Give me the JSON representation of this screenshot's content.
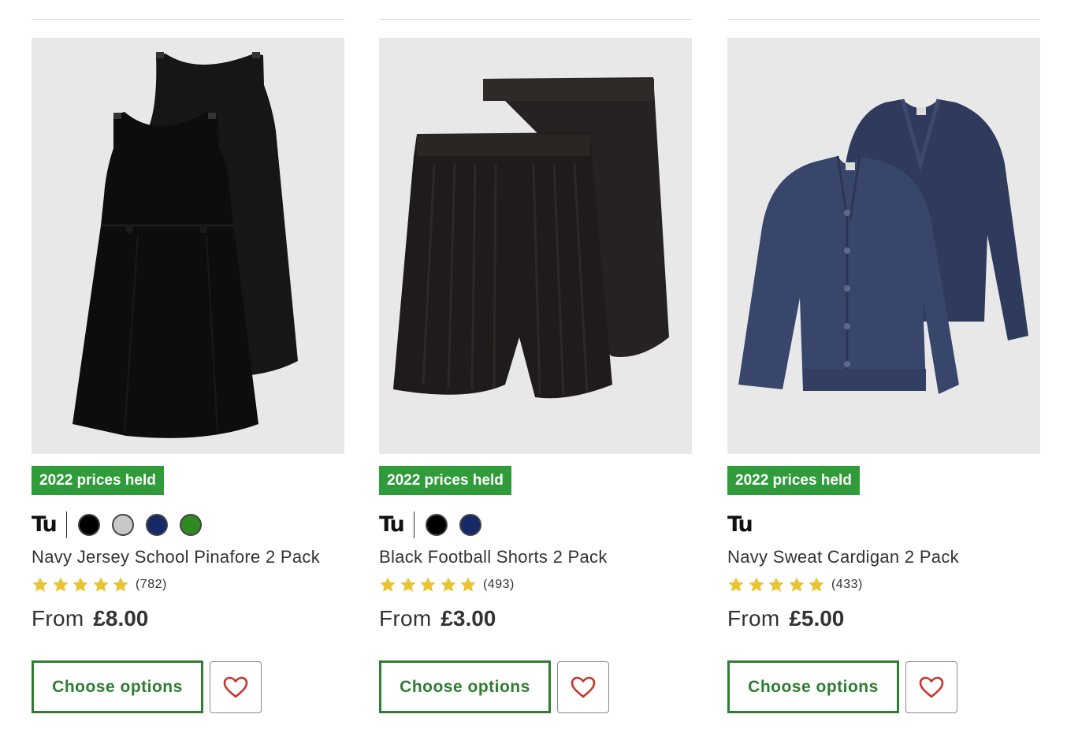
{
  "colors": {
    "badge_bg": "#2f9b3a",
    "button_green": "#2e7d32",
    "star_gold": "#e8c332",
    "heart_red": "#c8342b"
  },
  "products": [
    {
      "image_alt": "Two black sleeveless school pinafore dresses",
      "badge": "2022 prices held",
      "brand": "Tu",
      "swatches": [
        "#000000",
        "#c8c8c8",
        "#152a66",
        "#2f8a22"
      ],
      "title": "Navy Jersey School Pinafore 2 Pack",
      "rating_stars": 5,
      "review_count": "(782)",
      "price_prefix": "From",
      "price": "£8.00",
      "button_label": "Choose options",
      "wishlist_icon": "heart-outline-icon"
    },
    {
      "image_alt": "Two black football shorts",
      "badge": "2022 prices held",
      "brand": "Tu",
      "swatches": [
        "#000000",
        "#152a66"
      ],
      "title": "Black Football Shorts 2 Pack",
      "rating_stars": 5,
      "review_count": "(493)",
      "price_prefix": "From",
      "price": "£3.00",
      "button_label": "Choose options",
      "wishlist_icon": "heart-outline-icon"
    },
    {
      "image_alt": "Two navy sweat cardigans",
      "badge": "2022 prices held",
      "brand": "Tu",
      "swatches": [],
      "title": "Navy Sweat Cardigan 2 Pack",
      "rating_stars": 5,
      "review_count": "(433)",
      "price_prefix": "From",
      "price": "£5.00",
      "button_label": "Choose options",
      "wishlist_icon": "heart-outline-icon"
    }
  ]
}
